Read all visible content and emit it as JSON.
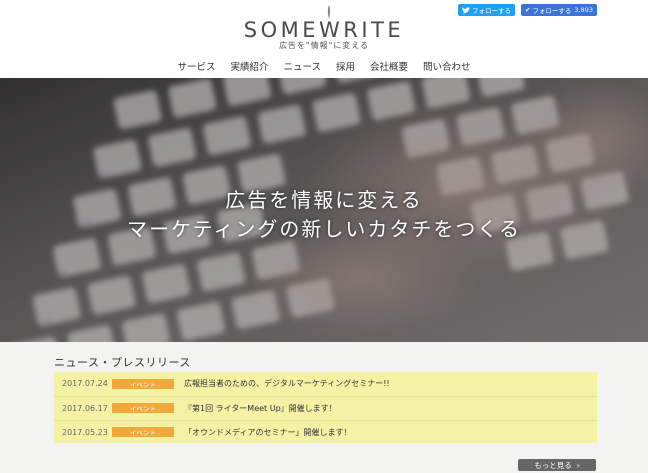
{
  "header": {
    "logo": "SOMEWRITE",
    "tagline": "広告を\"情報\"に変える",
    "social": {
      "twitter_label": "フォローする",
      "facebook_label": "フォローする",
      "facebook_count": "3,893"
    },
    "nav": [
      "サービス",
      "実績紹介",
      "ニュース",
      "採用",
      "会社概要",
      "問い合わせ"
    ]
  },
  "hero": {
    "line1": "広告を情報に変える",
    "line2": "マーケティングの新しいカタチをつくる"
  },
  "news_section": {
    "title": "ニュース・プレスリリース",
    "items": [
      {
        "date": "2017.07.24",
        "badge": "イベント",
        "title": "広報担当者のための、デジタルマーケティングセミナー!!"
      },
      {
        "date": "2017.06.17",
        "badge": "イベント",
        "title": "『第1回 ライターMeet Up』開催します！"
      },
      {
        "date": "2017.05.23",
        "badge": "イベント",
        "title": "「オウンドメディアのセミナー」開催します！"
      }
    ],
    "more_label": "もっと見る"
  },
  "colors": {
    "accent_badge": "#f2a93b",
    "news_bg": "#f5f2a5",
    "twitter": "#1da1f2",
    "facebook": "#3b74d9"
  }
}
